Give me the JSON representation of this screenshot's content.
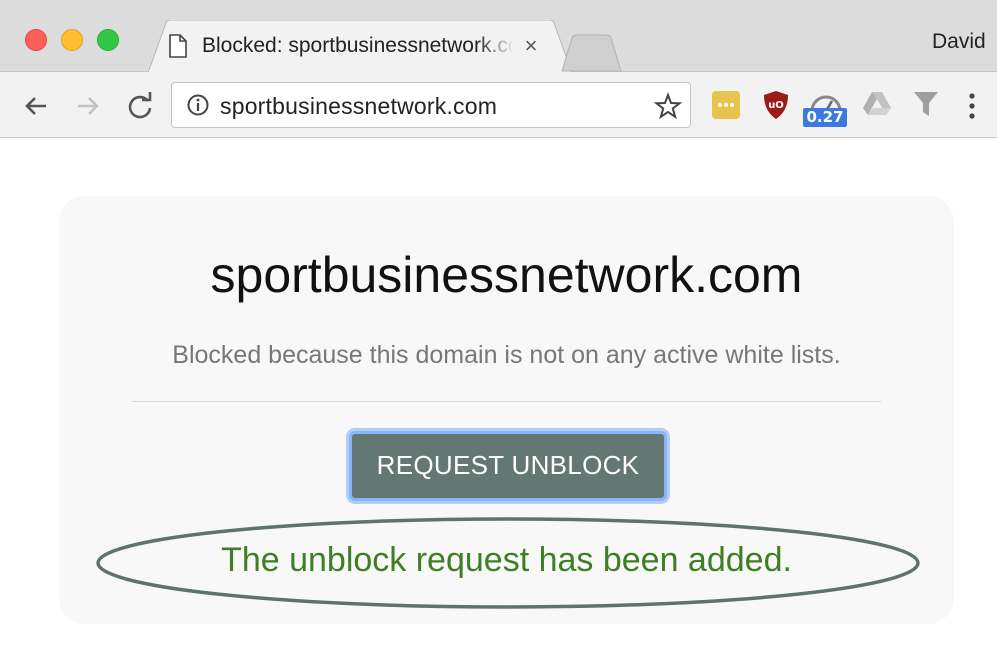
{
  "browser": {
    "tab": {
      "title": "Blocked: sportbusinessnetwork.com",
      "close_label": "×"
    },
    "profile_name": "David",
    "address_bar": {
      "url": "sportbusinessnetwork.com"
    },
    "extensions": [
      {
        "name": "more-dots-extension",
        "color": "#e8c44c"
      },
      {
        "name": "ublock-origin-extension",
        "color": "#9b1b1b"
      },
      {
        "name": "speedometer-extension",
        "badge": "0.27",
        "badge_color": "#3b7ae0"
      },
      {
        "name": "drive-extension",
        "color": "#bdbdbd"
      },
      {
        "name": "filter-extension",
        "color": "#9e9e9e"
      }
    ]
  },
  "page": {
    "domain_heading": "sportbusinessnetwork.com",
    "block_reason": "Blocked because this domain is not on any active white lists.",
    "request_button_label": "REQUEST UNBLOCK",
    "confirmation_message": "The unblock request has been added."
  },
  "colors": {
    "button_bg": "#637872",
    "button_focus_ring": "#8ab4f8",
    "confirmation_text": "#3e7e24",
    "annotation_ellipse": "#5f726d"
  }
}
